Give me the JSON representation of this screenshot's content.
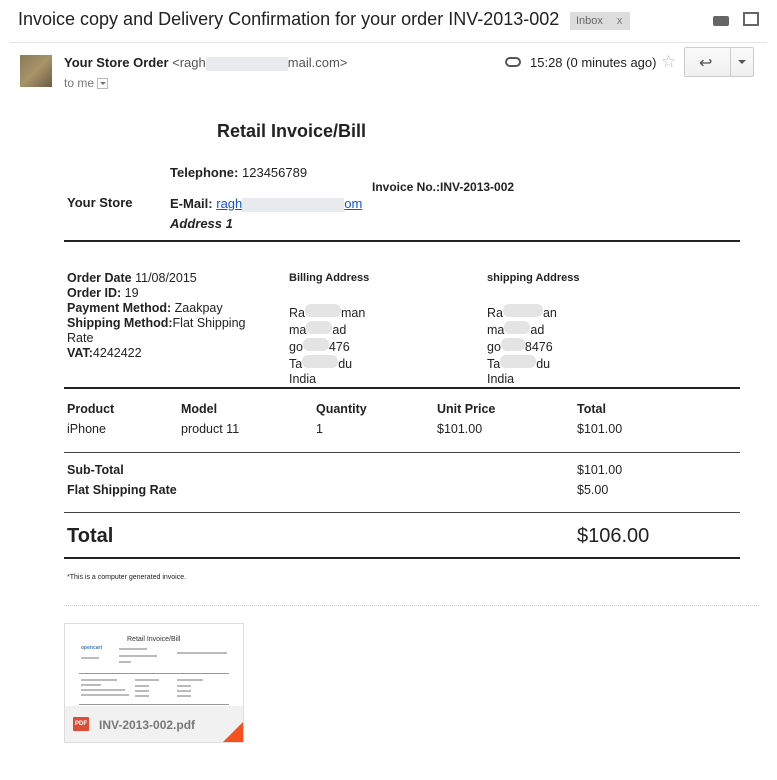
{
  "email": {
    "subject": "Invoice copy and Delivery Confirmation for your order INV-2013-002",
    "label": "Inbox",
    "label_close": "x",
    "sender_name": "Your Store Order",
    "sender_email_start": "<ragh",
    "sender_email_end": "mail.com>",
    "to": "to me",
    "time": "15:28 (0 minutes ago)"
  },
  "invoice": {
    "title": "Retail Invoice/Bill",
    "store_name": "Your Store",
    "telephone_label": "Telephone:",
    "telephone": "123456789",
    "email_label": "E-Mail:",
    "email_start": "ragh",
    "email_end": "om",
    "address": "Address 1",
    "invoice_no": "Invoice No.:INV-2013-002",
    "order": {
      "date_label": "Order Date",
      "date": "11/08/2015",
      "id_label": "Order ID:",
      "id": "19",
      "payment_label": "Payment Method:",
      "payment": "Zaakpay",
      "shipping_label": "Shipping Method:",
      "shipping": "Flat Shipping Rate",
      "vat_label": "VAT:",
      "vat": "4242422"
    },
    "billing": {
      "heading": "Billing Address",
      "lines": [
        "Ra",
        "man",
        "ma",
        "ad",
        "go",
        "476",
        "Ta",
        "du",
        "India"
      ]
    },
    "shipping_addr": {
      "heading": "shipping Address",
      "lines": [
        "Ra",
        "an",
        "ma",
        "ad",
        "go",
        "8476",
        "Ta",
        "du",
        "India"
      ]
    },
    "columns": {
      "product": "Product",
      "model": "Model",
      "quantity": "Quantity",
      "unit_price": "Unit Price",
      "total": "Total"
    },
    "item": {
      "product": "iPhone",
      "model": "product 11",
      "quantity": "1",
      "unit_price": "$101.00",
      "total": "$101.00"
    },
    "subtotal_label": "Sub-Total",
    "subtotal": "$101.00",
    "shipping_rate_label": "Flat Shipping Rate",
    "shipping_rate": "$5.00",
    "total_label": "Total",
    "total": "$106.00",
    "footnote": "*This is a computer generated invoice."
  },
  "attachment": {
    "filename": "INV-2013-002.pdf",
    "icon_text": "PDF",
    "thumb_title": "Retail Invoice/Bill",
    "thumb_logo": "opencart"
  },
  "colors": {
    "link": "#1155cc",
    "pdf": "#dd4b39",
    "fold": "#f4511e"
  }
}
